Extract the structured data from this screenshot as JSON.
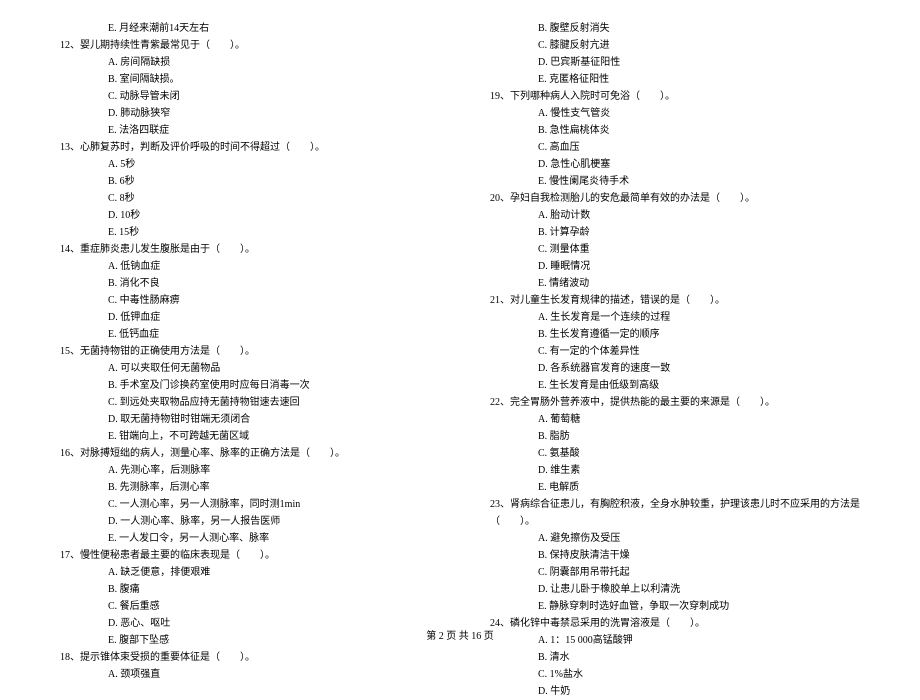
{
  "left_column": {
    "pre_option": "E. 月经来潮前14天左右",
    "q12": {
      "text": "12、婴儿期持续性青紫最常见于（　　）。",
      "options": [
        "A. 房间隔缺损",
        "B. 室间隔缺损。",
        "C. 动脉导管未闭",
        "D. 肺动脉狭窄",
        "E. 法洛四联症"
      ]
    },
    "q13": {
      "text": "13、心肺复苏时，判断及评价呼吸的时间不得超过（　　）。",
      "options": [
        "A. 5秒",
        "B. 6秒",
        "C. 8秒",
        "D. 10秒",
        "E. 15秒"
      ]
    },
    "q14": {
      "text": "14、重症肺炎患儿发生腹胀是由于（　　）。",
      "options": [
        "A. 低钠血症",
        "B. 消化不良",
        "C. 中毒性肠麻痹",
        "D. 低钾血症",
        "E. 低钙血症"
      ]
    },
    "q15": {
      "text": "15、无菌持物钳的正确使用方法是（　　）。",
      "options": [
        "A. 可以夹取任何无菌物品",
        "B. 手术室及门诊换药室使用时应每日消毒一次",
        "C. 到远处夹取物品应持无菌持物钳速去速回",
        "D. 取无菌持物钳时钳端无须闭合",
        "E. 钳端向上，不可跨越无菌区域"
      ]
    },
    "q16": {
      "text": "16、对脉搏短绌的病人，测量心率、脉率的正确方法是（　　）。",
      "options": [
        "A. 先测心率，后测脉率",
        "B. 先测脉率，后测心率",
        "C. 一人测心率，另一人测脉率，同时测1min",
        "D. 一人测心率、脉率，另一人报告医师",
        "E. 一人发口令，另一人测心率、脉率"
      ]
    },
    "q17": {
      "text": "17、慢性便秘患者最主要的临床表现是（　　）。",
      "options": [
        "A. 缺乏便意，排便艰难",
        "B. 腹痛",
        "C. 餐后重感",
        "D. 恶心、呕吐",
        "E. 腹部下坠感"
      ]
    },
    "q18": {
      "text": "18、提示锥体束受损的重要体征是（　　）。",
      "options_partial": [
        "A. 颈项强直"
      ]
    }
  },
  "right_column": {
    "pre_options": [
      "B. 腹壁反射消失",
      "C. 膝腱反射亢进",
      "D. 巴宾斯基征阳性",
      "E. 克匿格征阳性"
    ],
    "q19": {
      "text": "19、下列哪种病人入院时可免浴（　　）。",
      "options": [
        "A. 慢性支气管炎",
        "B. 急性扁桃体炎",
        "C. 高血压",
        "D. 急性心肌梗塞",
        "E. 慢性阑尾炎待手术"
      ]
    },
    "q20": {
      "text": "20、孕妇自我检测胎儿的安危最简单有效的办法是（　　）。",
      "options": [
        "A. 胎动计数",
        "B. 计算孕龄",
        "C. 测量体重",
        "D. 睡眠情况",
        "E. 情绪波动"
      ]
    },
    "q21": {
      "text": "21、对儿童生长发育规律的描述，错误的是（　　）。",
      "options": [
        "A. 生长发育是一个连续的过程",
        "B. 生长发育遵循一定的顺序",
        "C. 有一定的个体差异性",
        "D. 各系统器官发育的速度一致",
        "E. 生长发育是由低级到高级"
      ]
    },
    "q22": {
      "text": "22、完全胃肠外营养液中，提供热能的最主要的来源是（　　）。",
      "options": [
        "A. 葡萄糖",
        "B. 脂肪",
        "C. 氨基酸",
        "D. 维生素",
        "E. 电解质"
      ]
    },
    "q23": {
      "text": "23、肾病综合征患儿，有胸腔积液，全身水肿较重，护理该患儿时不应采用的方法是（　　）。",
      "options": [
        "A. 避免擦伤及受压",
        "B. 保持皮肤清洁干燥",
        "C. 阴囊部用吊带托起",
        "D. 让患儿卧于橡胶单上以利清洗",
        "E. 静脉穿刺时选好血管，争取一次穿刺成功"
      ]
    },
    "q24": {
      "text": "24、磷化锌中毒禁忌采用的洗胃溶液是（　　）。",
      "options_partial": [
        "A. 1：15 000高锰酸钾",
        "B. 清水",
        "C. 1%盐水",
        "D. 牛奶"
      ]
    }
  },
  "footer": "第 2 页 共 16 页"
}
